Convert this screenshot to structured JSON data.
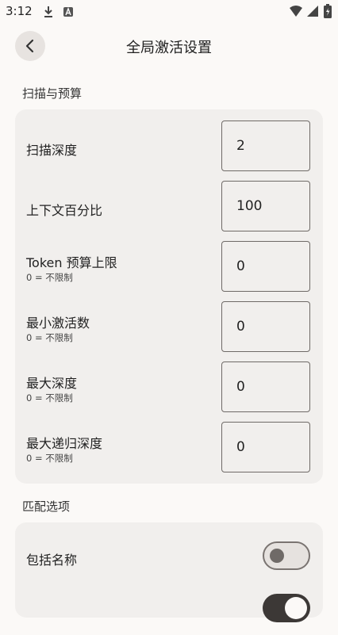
{
  "status_bar": {
    "time": "3:12"
  },
  "header": {
    "title": "全局激活设置"
  },
  "sections": {
    "scan_budget": {
      "label": "扫描与预算",
      "rows": [
        {
          "label": "扫描深度",
          "hint": "",
          "value": "2"
        },
        {
          "label": "上下文百分比",
          "hint": "",
          "value": "100"
        },
        {
          "label": "Token 预算上限",
          "hint": "0 = 不限制",
          "value": "0"
        },
        {
          "label": "最小激活数",
          "hint": "0 = 不限制",
          "value": "0"
        },
        {
          "label": "最大深度",
          "hint": "0 = 不限制",
          "value": "0"
        },
        {
          "label": "最大递归深度",
          "hint": "0 = 不限制",
          "value": "0"
        }
      ]
    },
    "match_options": {
      "label": "匹配选项",
      "rows": [
        {
          "label": "包括名称",
          "checked": false
        },
        {
          "label": "",
          "checked": true
        }
      ]
    }
  },
  "colors": {
    "card_bg": "#f1efed",
    "page_bg": "#fbf9f7",
    "toggle_on": "#3c3836"
  }
}
